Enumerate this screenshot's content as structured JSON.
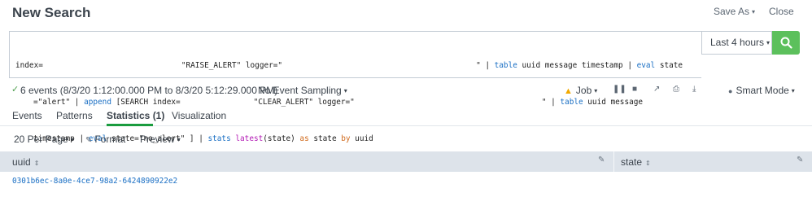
{
  "header": {
    "title": "New Search",
    "save_as": "Save As",
    "close": "Close"
  },
  "search": {
    "line1": {
      "a": "index=",
      "b": "\"RAISE_ALERT\" logger=\"",
      "c": "\" | ",
      "d": "table",
      "e": " uuid message timestamp | ",
      "f": "eval",
      "g": " state"
    },
    "line2": {
      "a": "=\"alert\" | ",
      "b": "append",
      "c": " [SEARCH index=",
      "d": "\"CLEAR_ALERT\" logger=\"",
      "e": "\" | ",
      "f": "table",
      "g": " uuid message"
    },
    "line3": {
      "a": "timestamp | ",
      "b": "eval",
      "c": " state=\"no_alert\" ] | ",
      "d": "stats",
      "e": " ",
      "f": "latest",
      "g": "(state) ",
      "h": "as",
      "i": " state ",
      "j": "by",
      "k": " uuid"
    },
    "time_range": "Last 4 hours",
    "search_button_icon": "search-icon"
  },
  "status": {
    "events": "6 events (8/3/20 1:12:00.000 PM to 8/3/20 5:12:29.000 PM)",
    "sampling": "No Event Sampling",
    "job": "Job",
    "smart_mode": "Smart Mode"
  },
  "tabs": [
    {
      "label": "Events"
    },
    {
      "label": "Patterns"
    },
    {
      "label": "Statistics (1)"
    },
    {
      "label": "Visualization"
    }
  ],
  "controls": {
    "per_page": "20 Per Page",
    "format": "Format",
    "preview": "Preview"
  },
  "table": {
    "columns": [
      "uuid",
      "state"
    ],
    "rows": [
      {
        "uuid": "0301b6ec-8a0e-4ce7-98a2-6424890922e2",
        "state": ""
      }
    ]
  },
  "colors": {
    "accent_green": "#5cc05c",
    "active_tab_underline": "#1a9c3e",
    "keyword_blue": "#1a6fc4",
    "function_purple": "#b31bb5",
    "warning_yellow": "#f2a900"
  }
}
